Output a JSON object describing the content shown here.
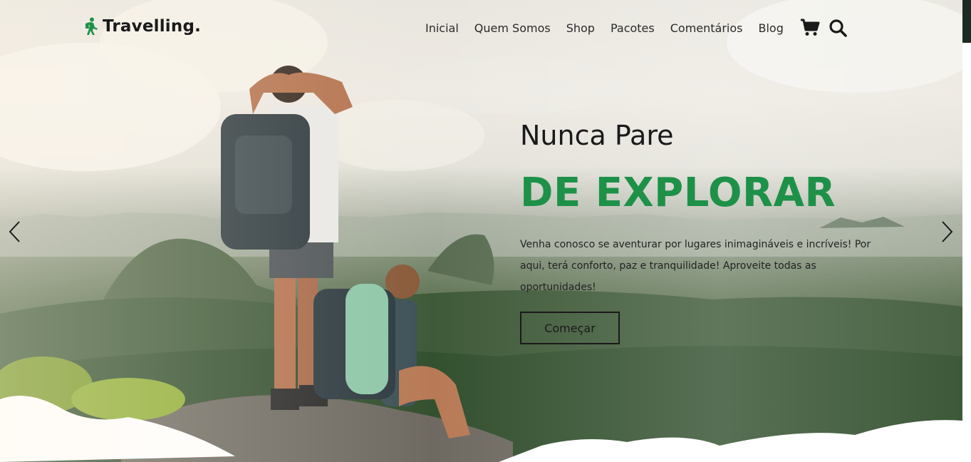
{
  "brand": {
    "name": "Travelling.",
    "icon": "hiker-icon",
    "accent_color": "#1e9149"
  },
  "nav": {
    "items": [
      {
        "label": "Inicial"
      },
      {
        "label": "Quem Somos"
      },
      {
        "label": "Shop"
      },
      {
        "label": "Pacotes"
      },
      {
        "label": "Comentários"
      },
      {
        "label": "Blog"
      }
    ],
    "icons": [
      "cart-icon",
      "search-icon"
    ]
  },
  "hero": {
    "subtitle": "Nunca Pare",
    "title": "DE EXPLORAR",
    "text": "Venha conosco se aventurar por lugares inimagináveis e incríveis! Por aqui, terá conforto, paz e tranquilidade! Aproveite todas as oportunidades!",
    "cta_label": "Começar"
  },
  "carousel": {
    "prev_icon": "chevron-left-icon",
    "next_icon": "chevron-right-icon"
  }
}
